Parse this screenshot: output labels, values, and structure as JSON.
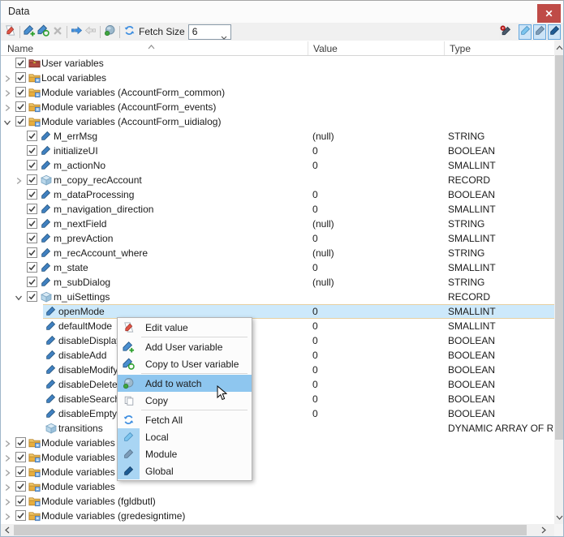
{
  "window": {
    "title": "Data",
    "close_icon": "close-x"
  },
  "toolbar": {
    "fetch_size_label": "Fetch Size",
    "fetch_size_value": "6",
    "buttons": [
      {
        "name": "edit-value-button",
        "icon": "edit-value-icon",
        "enabled": true
      },
      {
        "name": "add-user-variable-button",
        "icon": "add-variable-icon",
        "enabled": true
      },
      {
        "name": "copy-to-user-variable-button",
        "icon": "copy-variable-icon",
        "enabled": true
      },
      {
        "name": "delete-variable-button",
        "icon": "delete-x-icon",
        "enabled": false
      },
      {
        "name": "next-button",
        "icon": "arrow-right-icon",
        "enabled": true
      },
      {
        "name": "previous-button",
        "icon": "arrow-left-icon",
        "enabled": false
      },
      {
        "name": "add-to-watch-button",
        "icon": "watch-globe-icon",
        "enabled": true
      },
      {
        "name": "fetch-button",
        "icon": "refresh-icon",
        "enabled": true
      }
    ],
    "separators_after": [
      0,
      3,
      5,
      6
    ],
    "right_buttons": [
      {
        "name": "edit-breakpoint-button",
        "icon": "record-pencil-icon",
        "pressed": false
      },
      {
        "name": "show-local-button",
        "icon": "pencil-light-icon",
        "pressed": true
      },
      {
        "name": "show-module-button",
        "icon": "pencil-medium-icon",
        "pressed": true
      },
      {
        "name": "show-global-button",
        "icon": "pencil-dark-icon",
        "pressed": true
      }
    ]
  },
  "columns": [
    {
      "label": "Name"
    },
    {
      "label": "Value"
    },
    {
      "label": "Type"
    }
  ],
  "tree": {
    "rows": [
      {
        "level": 0,
        "expander": "none",
        "checkbox": true,
        "icon": "folder-red",
        "name": "User variables",
        "value": "",
        "type": "",
        "selected": false
      },
      {
        "level": 0,
        "expander": "collapsed",
        "checkbox": true,
        "icon": "folder",
        "name": "Local variables",
        "value": "",
        "type": "",
        "selected": false
      },
      {
        "level": 0,
        "expander": "collapsed",
        "checkbox": true,
        "icon": "folder",
        "name": "Module variables (AccountForm_common)",
        "value": "",
        "type": "",
        "selected": false
      },
      {
        "level": 0,
        "expander": "collapsed",
        "checkbox": true,
        "icon": "folder",
        "name": "Module variables (AccountForm_events)",
        "value": "",
        "type": "",
        "selected": false
      },
      {
        "level": 0,
        "expander": "expanded",
        "checkbox": true,
        "icon": "folder",
        "name": "Module variables (AccountForm_uidialog)",
        "value": "",
        "type": "",
        "selected": false
      },
      {
        "level": 1,
        "expander": "none",
        "checkbox": true,
        "icon": "variable",
        "name": "M_errMsg",
        "value": "(null)",
        "type": "STRING",
        "selected": false
      },
      {
        "level": 1,
        "expander": "none",
        "checkbox": true,
        "icon": "variable",
        "name": "initializeUI",
        "value": "0",
        "type": "BOOLEAN",
        "selected": false
      },
      {
        "level": 1,
        "expander": "none",
        "checkbox": true,
        "icon": "variable",
        "name": "m_actionNo",
        "value": "0",
        "type": "SMALLINT",
        "selected": false
      },
      {
        "level": 1,
        "expander": "collapsed",
        "checkbox": true,
        "icon": "record",
        "name": "m_copy_recAccount",
        "value": "",
        "type": "RECORD",
        "selected": false
      },
      {
        "level": 1,
        "expander": "none",
        "checkbox": true,
        "icon": "variable",
        "name": "m_dataProcessing",
        "value": "0",
        "type": "BOOLEAN",
        "selected": false
      },
      {
        "level": 1,
        "expander": "none",
        "checkbox": true,
        "icon": "variable",
        "name": "m_navigation_direction",
        "value": "0",
        "type": "SMALLINT",
        "selected": false
      },
      {
        "level": 1,
        "expander": "none",
        "checkbox": true,
        "icon": "variable",
        "name": "m_nextField",
        "value": "(null)",
        "type": "STRING",
        "selected": false
      },
      {
        "level": 1,
        "expander": "none",
        "checkbox": true,
        "icon": "variable",
        "name": "m_prevAction",
        "value": "0",
        "type": "SMALLINT",
        "selected": false
      },
      {
        "level": 1,
        "expander": "none",
        "checkbox": true,
        "icon": "variable",
        "name": "m_recAccount_where",
        "value": "(null)",
        "type": "STRING",
        "selected": false
      },
      {
        "level": 1,
        "expander": "none",
        "checkbox": true,
        "icon": "variable",
        "name": "m_state",
        "value": "0",
        "type": "SMALLINT",
        "selected": false
      },
      {
        "level": 1,
        "expander": "none",
        "checkbox": true,
        "icon": "variable",
        "name": "m_subDialog",
        "value": "(null)",
        "type": "STRING",
        "selected": false
      },
      {
        "level": 1,
        "expander": "expanded",
        "checkbox": true,
        "icon": "record",
        "name": "m_uiSettings",
        "value": "",
        "type": "RECORD",
        "selected": false
      },
      {
        "level": 2,
        "expander": "none",
        "checkbox": false,
        "icon": "variable",
        "name": "openMode",
        "value": "0",
        "type": "SMALLINT",
        "selected": true
      },
      {
        "level": 2,
        "expander": "none",
        "checkbox": false,
        "icon": "variable",
        "name": "defaultMode",
        "value": "0",
        "type": "SMALLINT",
        "selected": false
      },
      {
        "level": 2,
        "expander": "none",
        "checkbox": false,
        "icon": "variable",
        "name": "disableDisplay",
        "value": "0",
        "type": "BOOLEAN",
        "selected": false
      },
      {
        "level": 2,
        "expander": "none",
        "checkbox": false,
        "icon": "variable",
        "name": "disableAdd",
        "value": "0",
        "type": "BOOLEAN",
        "selected": false
      },
      {
        "level": 2,
        "expander": "none",
        "checkbox": false,
        "icon": "variable",
        "name": "disableModify",
        "value": "0",
        "type": "BOOLEAN",
        "selected": false
      },
      {
        "level": 2,
        "expander": "none",
        "checkbox": false,
        "icon": "variable",
        "name": "disableDelete",
        "value": "0",
        "type": "BOOLEAN",
        "selected": false
      },
      {
        "level": 2,
        "expander": "none",
        "checkbox": false,
        "icon": "variable",
        "name": "disableSearch",
        "value": "0",
        "type": "BOOLEAN",
        "selected": false
      },
      {
        "level": 2,
        "expander": "none",
        "checkbox": false,
        "icon": "variable",
        "name": "disableEmpty",
        "value": "0",
        "type": "BOOLEAN",
        "selected": false
      },
      {
        "level": 2,
        "expander": "none",
        "checkbox": false,
        "icon": "record",
        "name": "transitions",
        "value": "",
        "type": "DYNAMIC ARRAY OF RECORD",
        "selected": false
      },
      {
        "level": 0,
        "expander": "collapsed",
        "checkbox": true,
        "icon": "folder",
        "name": "Module variables",
        "value": "",
        "type": "",
        "selected": false
      },
      {
        "level": 0,
        "expander": "collapsed",
        "checkbox": true,
        "icon": "folder",
        "name": "Module variables",
        "value": "",
        "type": "",
        "selected": false
      },
      {
        "level": 0,
        "expander": "collapsed",
        "checkbox": true,
        "icon": "folder",
        "name": "Module variables",
        "value": "",
        "type": "",
        "selected": false
      },
      {
        "level": 0,
        "expander": "collapsed",
        "checkbox": true,
        "icon": "folder",
        "name": "Module variables",
        "value": "",
        "type": "",
        "selected": false
      },
      {
        "level": 0,
        "expander": "collapsed",
        "checkbox": true,
        "icon": "folder",
        "name": "Module variables (fgldbutl)",
        "value": "",
        "type": "",
        "selected": false
      },
      {
        "level": 0,
        "expander": "collapsed",
        "checkbox": true,
        "icon": "folder",
        "name": "Module variables (gredesigntime)",
        "value": "",
        "type": "",
        "selected": false
      }
    ]
  },
  "menu": {
    "items": [
      {
        "icon": "edit-value-icon",
        "label": "Edit value",
        "highlighted": false,
        "checked": false
      },
      {
        "separator": true
      },
      {
        "icon": "add-variable-icon",
        "label": "Add User variable",
        "highlighted": false,
        "checked": false
      },
      {
        "icon": "copy-variable-icon",
        "label": "Copy to User variable",
        "highlighted": false,
        "checked": false
      },
      {
        "separator": true
      },
      {
        "icon": "watch-globe-icon",
        "label": "Add to watch",
        "highlighted": true,
        "checked": false
      },
      {
        "icon": "copy-icon",
        "label": "Copy",
        "highlighted": false,
        "checked": false
      },
      {
        "separator": true
      },
      {
        "icon": "refresh-icon",
        "label": "Fetch All",
        "highlighted": false,
        "checked": false
      },
      {
        "icon": "pencil-light-icon",
        "label": "Local",
        "highlighted": false,
        "checked": true
      },
      {
        "icon": "pencil-medium-icon",
        "label": "Module",
        "highlighted": false,
        "checked": true
      },
      {
        "icon": "pencil-dark-icon",
        "label": "Global",
        "highlighted": false,
        "checked": true
      }
    ]
  },
  "colors": {
    "selection_bg": "#cde9fb",
    "selection_border": "#e7cfa0",
    "menu_highlight": "#8ec6ef",
    "menu_checked_bg": "#a9d5f3",
    "close_button": "#bf4b47",
    "toolbar_bg": "#f0f0f0",
    "accent_blue": "#3e8ee0"
  }
}
